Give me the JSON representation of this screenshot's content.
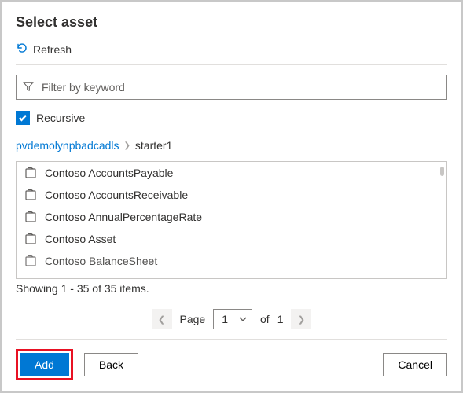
{
  "title": "Select asset",
  "refresh_label": "Refresh",
  "filter": {
    "placeholder": "Filter by keyword",
    "value": ""
  },
  "recursive": {
    "label": "Recursive",
    "checked": true
  },
  "breadcrumb": {
    "root": "pvdemolynpbadcadls",
    "current": "starter1"
  },
  "assets": [
    {
      "name": "Contoso AccountsPayable"
    },
    {
      "name": "Contoso AccountsReceivable"
    },
    {
      "name": "Contoso AnnualPercentageRate"
    },
    {
      "name": "Contoso Asset"
    },
    {
      "name": "Contoso BalanceSheet"
    }
  ],
  "showing_text": "Showing 1 - 35 of 35 items.",
  "pager": {
    "page_label": "Page",
    "current_page": "1",
    "of_label": "of",
    "total_pages": "1"
  },
  "buttons": {
    "add": "Add",
    "back": "Back",
    "cancel": "Cancel"
  },
  "colors": {
    "accent": "#0078d4",
    "highlight": "#e81123"
  }
}
